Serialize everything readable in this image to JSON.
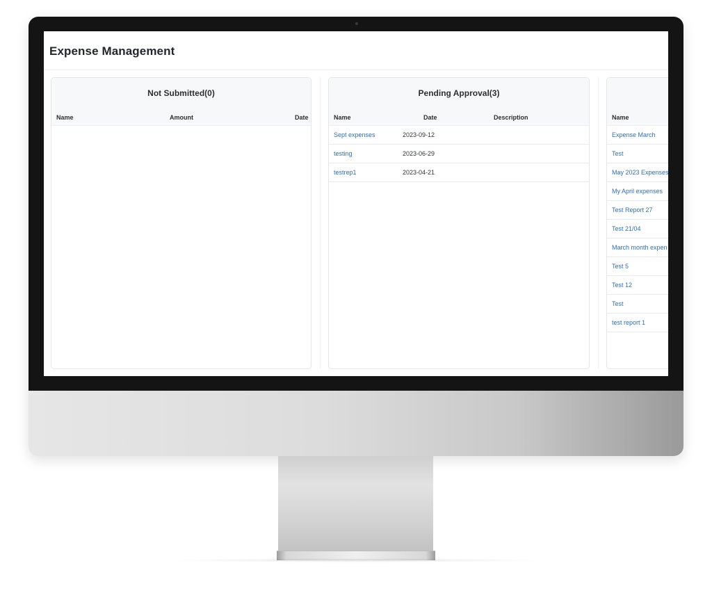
{
  "app": {
    "title": "Expense Management"
  },
  "panels": {
    "not_submitted": {
      "title": "Not Submitted(0)",
      "columns": [
        "Name",
        "Amount",
        "Date"
      ],
      "rows": []
    },
    "pending": {
      "title": "Pending Approval(3)",
      "columns": [
        "Name",
        "Date",
        "Description"
      ],
      "rows": [
        {
          "name": "Sept expenses",
          "date": "2023-09-12",
          "description": ""
        },
        {
          "name": "testing",
          "date": "2023-06-29",
          "description": ""
        },
        {
          "name": "testrep1",
          "date": "2023-04-21",
          "description": ""
        }
      ]
    },
    "third": {
      "title": "",
      "columns": [
        "Name"
      ],
      "rows": [
        {
          "name": "Expense March"
        },
        {
          "name": "Test"
        },
        {
          "name": "May 2023 Expenses"
        },
        {
          "name": "My April expenses"
        },
        {
          "name": "Test Report 27"
        },
        {
          "name": "Test 21/04"
        },
        {
          "name": "March month expen"
        },
        {
          "name": "Test 5"
        },
        {
          "name": "Test 12"
        },
        {
          "name": "Test"
        },
        {
          "name": "test report 1"
        }
      ]
    }
  },
  "colors": {
    "link": "#2f6fb3",
    "header_bg": "#f7f8fa",
    "bezel": "#141414"
  }
}
